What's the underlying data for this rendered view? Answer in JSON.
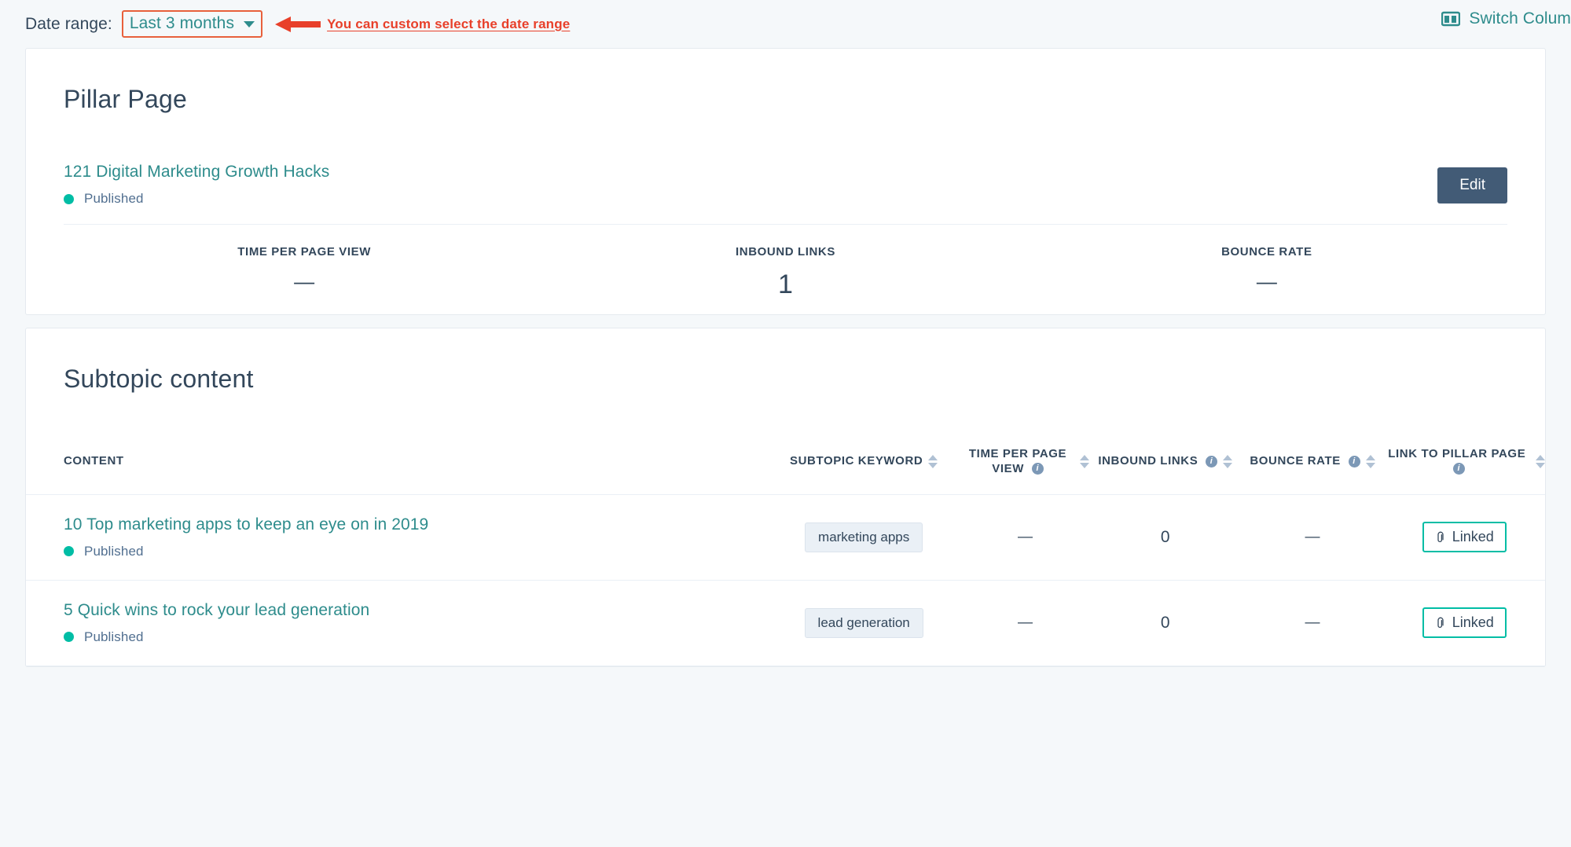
{
  "topbar": {
    "date_range_label": "Date range:",
    "date_range_value": "Last 3 months",
    "annotation": "You can custom select the date range",
    "switch_columns_label": "Switch Colum",
    "accent_teal": "#2e8c8c",
    "annotation_red": "#e8402a"
  },
  "pillar": {
    "heading": "Pillar Page",
    "page_title": "121 Digital Marketing Growth Hacks",
    "status": "Published",
    "status_color": "#00bda5",
    "edit_label": "Edit",
    "metrics": [
      {
        "label": "TIME PER PAGE VIEW",
        "value": "—"
      },
      {
        "label": "INBOUND LINKS",
        "value": "1"
      },
      {
        "label": "BOUNCE RATE",
        "value": "—"
      }
    ]
  },
  "subtopic": {
    "heading": "Subtopic content",
    "columns": {
      "content": "CONTENT",
      "keyword": "SUBTOPIC KEYWORD",
      "time_per_page_view": "TIME PER PAGE VIEW",
      "inbound_links": "INBOUND LINKS",
      "bounce_rate": "BOUNCE RATE",
      "link_to_pillar": "LINK TO PILLAR PAGE"
    },
    "rows": [
      {
        "title": "10 Top marketing apps to keep an eye on in 2019",
        "status": "Published",
        "keyword": "marketing apps",
        "time_per_page_view": "—",
        "inbound_links": "0",
        "bounce_rate": "—",
        "link_to_pillar": "Linked"
      },
      {
        "title": "5 Quick wins to rock your lead generation",
        "status": "Published",
        "keyword": "lead generation",
        "time_per_page_view": "—",
        "inbound_links": "0",
        "bounce_rate": "—",
        "link_to_pillar": "Linked"
      }
    ]
  }
}
